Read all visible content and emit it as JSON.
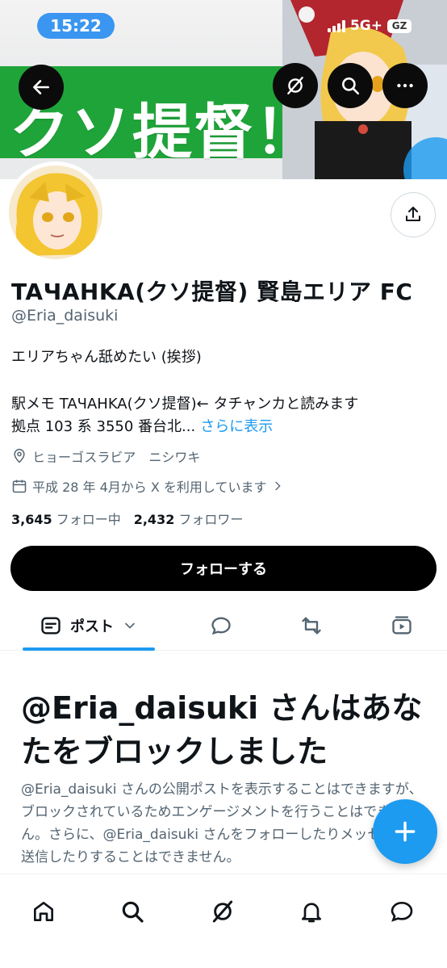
{
  "status_bar": {
    "time": "15:22",
    "network": "5G+",
    "battery": "GZ"
  },
  "banner": {
    "text": "クソ提督！"
  },
  "header_buttons": [
    "back-icon",
    "grok-icon",
    "search-icon",
    "more-icon"
  ],
  "profile": {
    "display_name": "TAЧAHKA(クソ提督) 賢島エリア FC",
    "handle": "@Eria_daisuki",
    "bio_line1": "エリアちゃん舐めたい (挨拶)",
    "bio_line2": "駅メモ TAЧAHKA(クソ提督)← タチャンカと読みます",
    "bio_line3": "拠点 103 系 3550 番台北...",
    "bio_more": "さらに表示",
    "location": "ヒョーゴスラビア　ニシワキ",
    "joined": "平成 28 年 4月から X を利用しています",
    "following_count": "3,645",
    "following_label": "フォロー中",
    "followers_count": "2,432",
    "followers_label": "フォロワー",
    "follow_button": "フォローする"
  },
  "tabs": {
    "posts_label": "ポスト"
  },
  "blocked": {
    "title": "@Eria_daisuki さんはあなたをブロックしました",
    "body": "@Eria_daisuki さんの公開ポストを表示することはできますが、ブロックされているためエンゲージメントを行うことはできません。さらに、@Eria_daisuki さんをフォローしたりメッセージを送信したりすることはできません。"
  },
  "colors": {
    "accent": "#1d9bf0",
    "banner_green": "#1fa43a",
    "text_secondary": "#536471"
  }
}
